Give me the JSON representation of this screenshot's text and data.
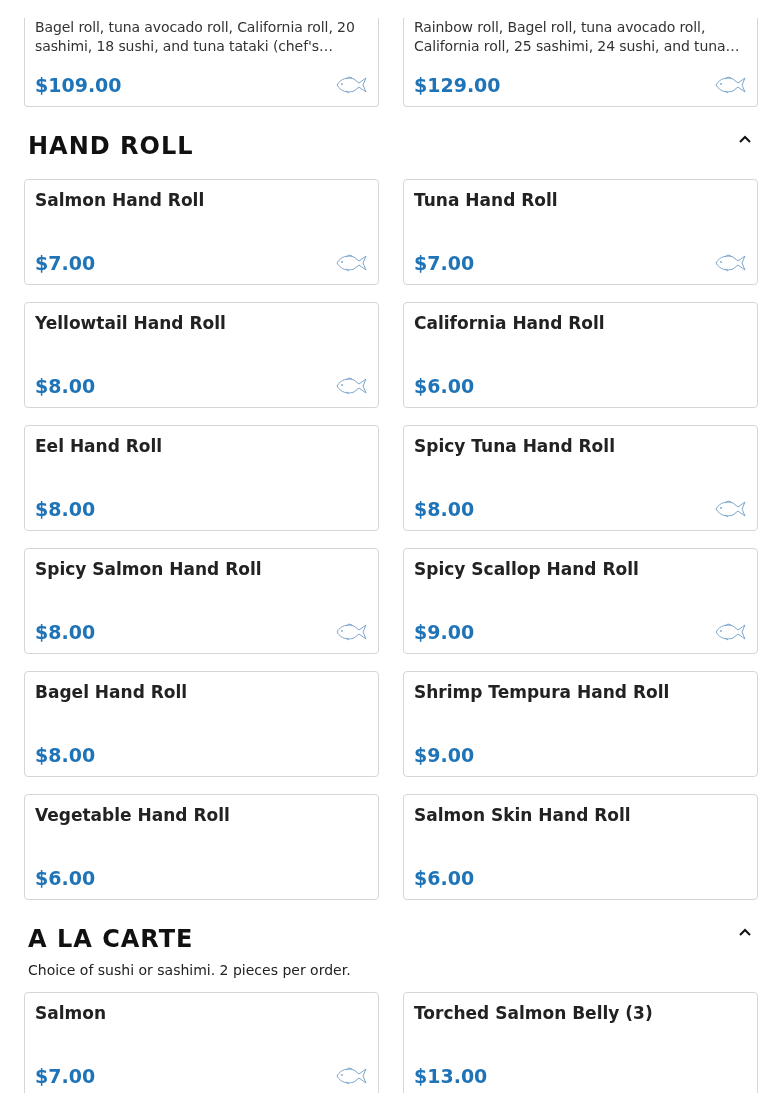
{
  "sections": [
    {
      "items": [
        {
          "description": "Bagel roll, tuna avocado roll, California roll, 20 sashimi, 18 sushi, and tuna tataki (chef's…",
          "price": "$109.00",
          "raw": true
        },
        {
          "description": "Rainbow roll, Bagel roll, tuna avocado roll, California roll, 25 sashimi, 24 sushi, and tuna…",
          "price": "$129.00",
          "raw": true
        }
      ]
    },
    {
      "title": "HAND ROLL",
      "expanded": true,
      "items": [
        {
          "name": "Salmon Hand Roll",
          "price": "$7.00",
          "raw": true
        },
        {
          "name": "Tuna Hand Roll",
          "price": "$7.00",
          "raw": true
        },
        {
          "name": "Yellowtail Hand Roll",
          "price": "$8.00",
          "raw": true
        },
        {
          "name": "California Hand Roll",
          "price": "$6.00",
          "raw": false
        },
        {
          "name": "Eel Hand Roll",
          "price": "$8.00",
          "raw": false
        },
        {
          "name": "Spicy Tuna Hand Roll",
          "price": "$8.00",
          "raw": true
        },
        {
          "name": "Spicy Salmon Hand Roll",
          "price": "$8.00",
          "raw": true
        },
        {
          "name": "Spicy Scallop Hand Roll",
          "price": "$9.00",
          "raw": true
        },
        {
          "name": "Bagel Hand Roll",
          "price": "$8.00",
          "raw": false
        },
        {
          "name": "Shrimp Tempura Hand Roll",
          "price": "$9.00",
          "raw": false
        },
        {
          "name": "Vegetable Hand Roll",
          "price": "$6.00",
          "raw": false
        },
        {
          "name": "Salmon Skin Hand Roll",
          "price": "$6.00",
          "raw": false
        }
      ]
    },
    {
      "title": "A LA CARTE",
      "expanded": true,
      "description": "Choice of sushi or sashimi. 2 pieces per order.",
      "items": [
        {
          "name": "Salmon",
          "price": "$7.00",
          "raw": true
        },
        {
          "name": "Torched Salmon Belly (3)",
          "price": "$13.00",
          "raw": false
        }
      ]
    }
  ]
}
